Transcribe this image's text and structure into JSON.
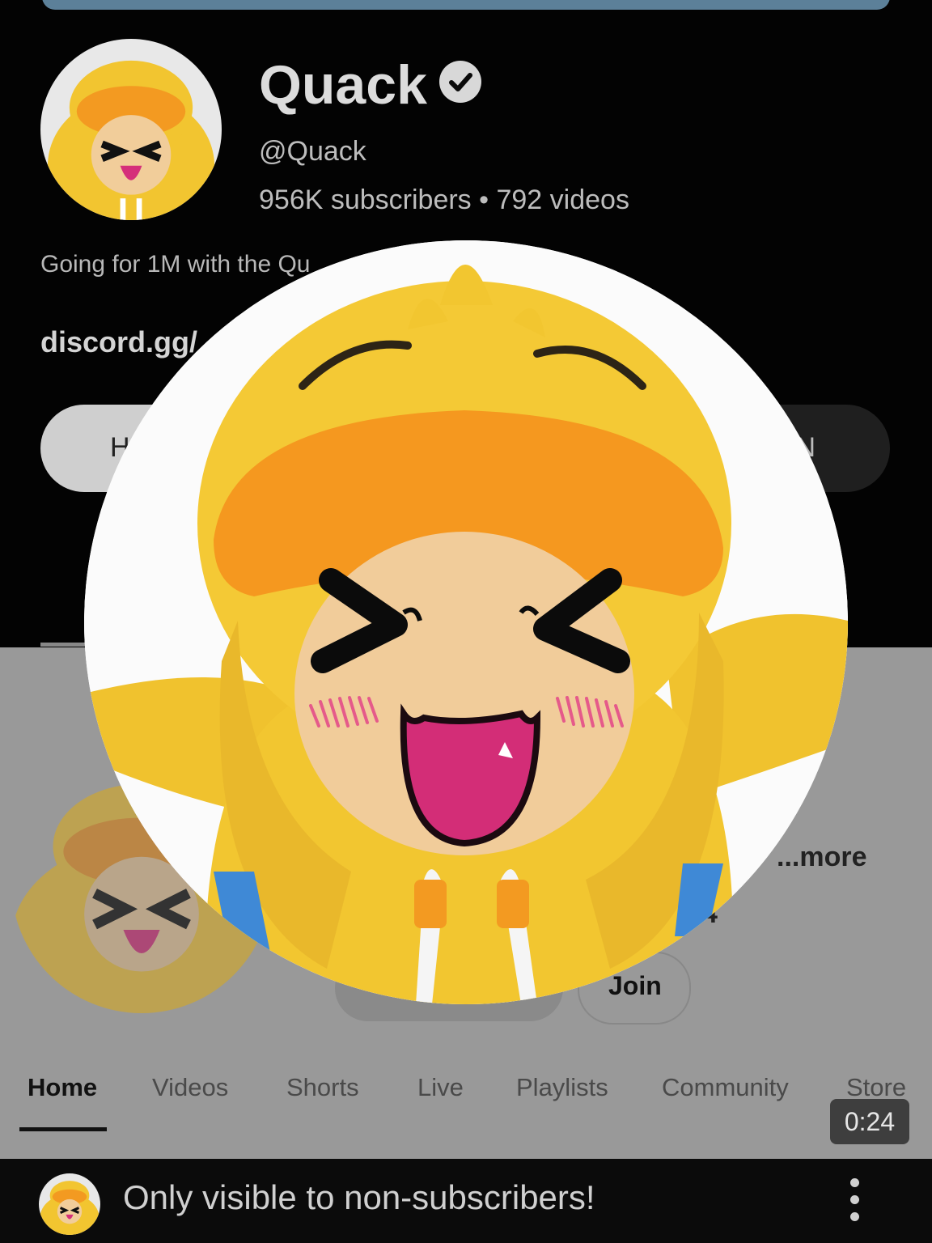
{
  "channel": {
    "name": "Quack",
    "handle": "@Quack",
    "stats": "956K subscribers • 792 videos",
    "description_visible": "Going for 1M with the Qu",
    "link_visible": "discord.gg/",
    "button_left_fragment": "H",
    "button_right_fragment": "N"
  },
  "lower": {
    "more_label": "...more",
    "count_fragment": "4",
    "join_label": "Join"
  },
  "tabs": [
    "Home",
    "Videos",
    "Shorts",
    "Live",
    "Playlists",
    "Community",
    "Store"
  ],
  "active_tab": "Home",
  "video": {
    "duration": "0:24"
  },
  "caption": {
    "text": "Only visible to non-subscribers!"
  },
  "colors": {
    "accent_yellow": "#F7C933",
    "hood_orange": "#F59A1F",
    "blush_pink": "#E55A8A",
    "mouth_magenta": "#D52F7A",
    "top_bar": "#5C8099"
  },
  "icons": [
    "verified-check-icon",
    "kebab-menu-icon"
  ]
}
